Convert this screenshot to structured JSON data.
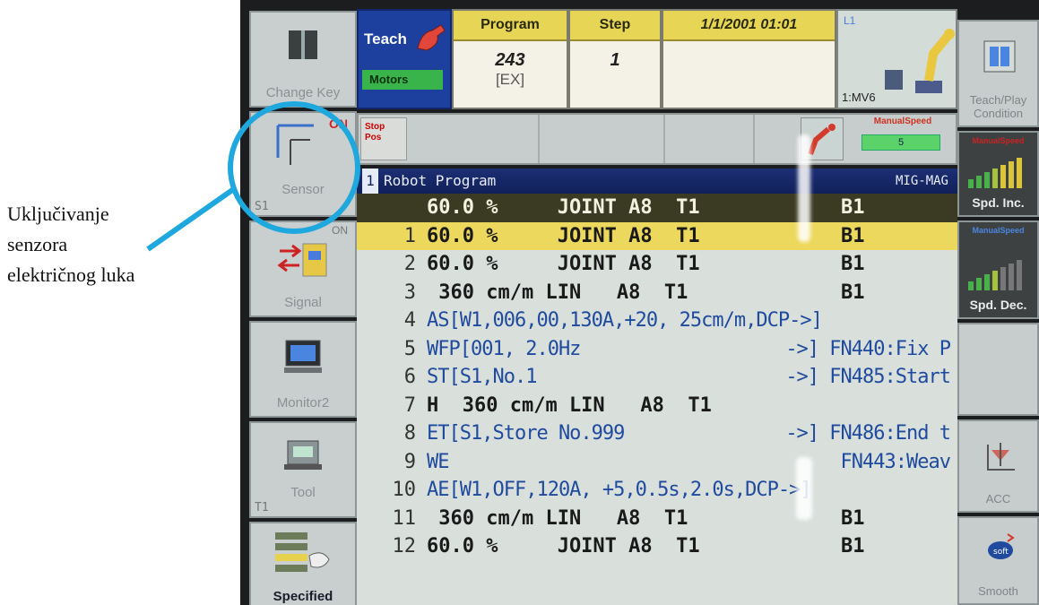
{
  "annotation": {
    "lines": [
      "Uključivanje",
      "senzora",
      "električnog luka"
    ],
    "color": "#1ea8dd"
  },
  "left_keys": [
    {
      "label": "Change Key",
      "icon": "book-icon"
    },
    {
      "label": "Sensor",
      "sub": "S1",
      "state": "ON",
      "icon": "sensor-icon"
    },
    {
      "label": "Signal",
      "state": "ON",
      "icon": "signal-icon"
    },
    {
      "label": "Monitor2",
      "icon": "monitor-icon"
    },
    {
      "label": "Tool",
      "sub": "T1",
      "icon": "tool-icon"
    },
    {
      "label": "Specified",
      "icon": "hand-list-icon"
    }
  ],
  "right_keys": [
    {
      "label": "Teach/Play Condition",
      "icon": "teach-play-icon"
    },
    {
      "label": "Spd. Inc.",
      "tiny": "ManualSpeed",
      "icon": "speed-up-icon"
    },
    {
      "label": "Spd. Dec.",
      "tiny": "ManualSpeed",
      "icon": "speed-down-icon"
    },
    {
      "label": "",
      "icon": ""
    },
    {
      "label": "ACC",
      "icon": "acc-icon"
    },
    {
      "label": "Smooth",
      "icon": "smooth-icon"
    }
  ],
  "status": {
    "mode": "Teach",
    "motors": "Motors",
    "program_head": "Program",
    "program_val": "243",
    "program_sub": "[EX]",
    "step_head": "Step",
    "step_val": "1",
    "datetime": "1/1/2001 01:01",
    "robot_id": "1:MV6",
    "robot_tag": "L1",
    "stop_pos": "Stop Pos",
    "manual_speed": "ManualSpeed",
    "manual_speed_val": "5"
  },
  "program": {
    "index": "1",
    "title": "Robot Program",
    "mode": "MIG-MAG",
    "lines": [
      {
        "n": "",
        "text": "60.0 %     JOINT A8  T1",
        "b": "B1",
        "kind": "hdr"
      },
      {
        "n": "1",
        "text": "60.0 %     JOINT A8  T1",
        "b": "B1",
        "kind": "sel"
      },
      {
        "n": "2",
        "text": "60.0 %     JOINT A8  T1",
        "b": "B1",
        "kind": "plain"
      },
      {
        "n": "3",
        "text": " 360 cm/m LIN   A8  T1",
        "b": "B1",
        "kind": "plain"
      },
      {
        "n": "4",
        "text": "AS[W1,006,00,130A,+20, 25cm/m,DCP->]",
        "kind": "blue"
      },
      {
        "n": "5",
        "text": "WFP[001, 2.0Hz",
        "comment": "->] FN440:Fix P",
        "kind": "blue"
      },
      {
        "n": "6",
        "text": "ST[S1,No.1",
        "comment": "->] FN485:Start",
        "kind": "blue"
      },
      {
        "n": "7",
        "text": "H  360 cm/m LIN   A8  T1",
        "kind": "plain"
      },
      {
        "n": "8",
        "text": "ET[S1,Store No.999",
        "comment": "->] FN486:End t",
        "kind": "blue"
      },
      {
        "n": "9",
        "text": "WE",
        "comment": "FN443:Weav",
        "kind": "blue"
      },
      {
        "n": "10",
        "text": "AE[W1,OFF,120A, +5,0.5s,2.0s,DCP->]",
        "kind": "blue"
      },
      {
        "n": "11",
        "text": " 360 cm/m LIN   A8  T1",
        "b": "B1",
        "kind": "plain"
      },
      {
        "n": "12",
        "text": "60.0 %     JOINT A8  T1",
        "b": "B1",
        "kind": "plain"
      }
    ]
  }
}
